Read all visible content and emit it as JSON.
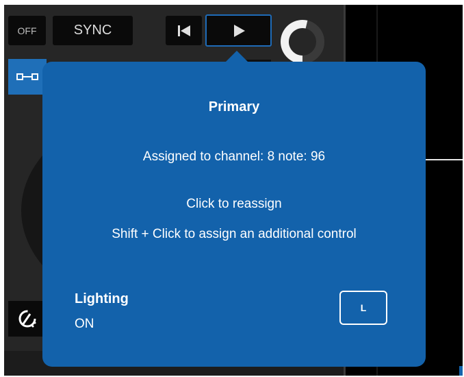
{
  "deck": {
    "off_label": "OFF",
    "sync_label": "SYNC",
    "icons": {
      "prev": "skip-to-start-icon",
      "play": "play-icon",
      "knob": "gain-knob",
      "link": "link-icon",
      "pitch": "pitch-dial-icon"
    }
  },
  "tooltip": {
    "title": "Primary",
    "assigned": "Assigned to channel: 8 note: 96",
    "click_hint": "Click to reassign",
    "shift_hint": "Shift + Click to assign an additional control",
    "lighting_label": "Lighting",
    "lighting_value": "ON",
    "key_label": "L"
  },
  "colors": {
    "tooltip_bg": "#1362ab",
    "deck_bg": "#262626",
    "button_bg": "#0a0a0a",
    "accent_blue": "#1f6fb8"
  }
}
